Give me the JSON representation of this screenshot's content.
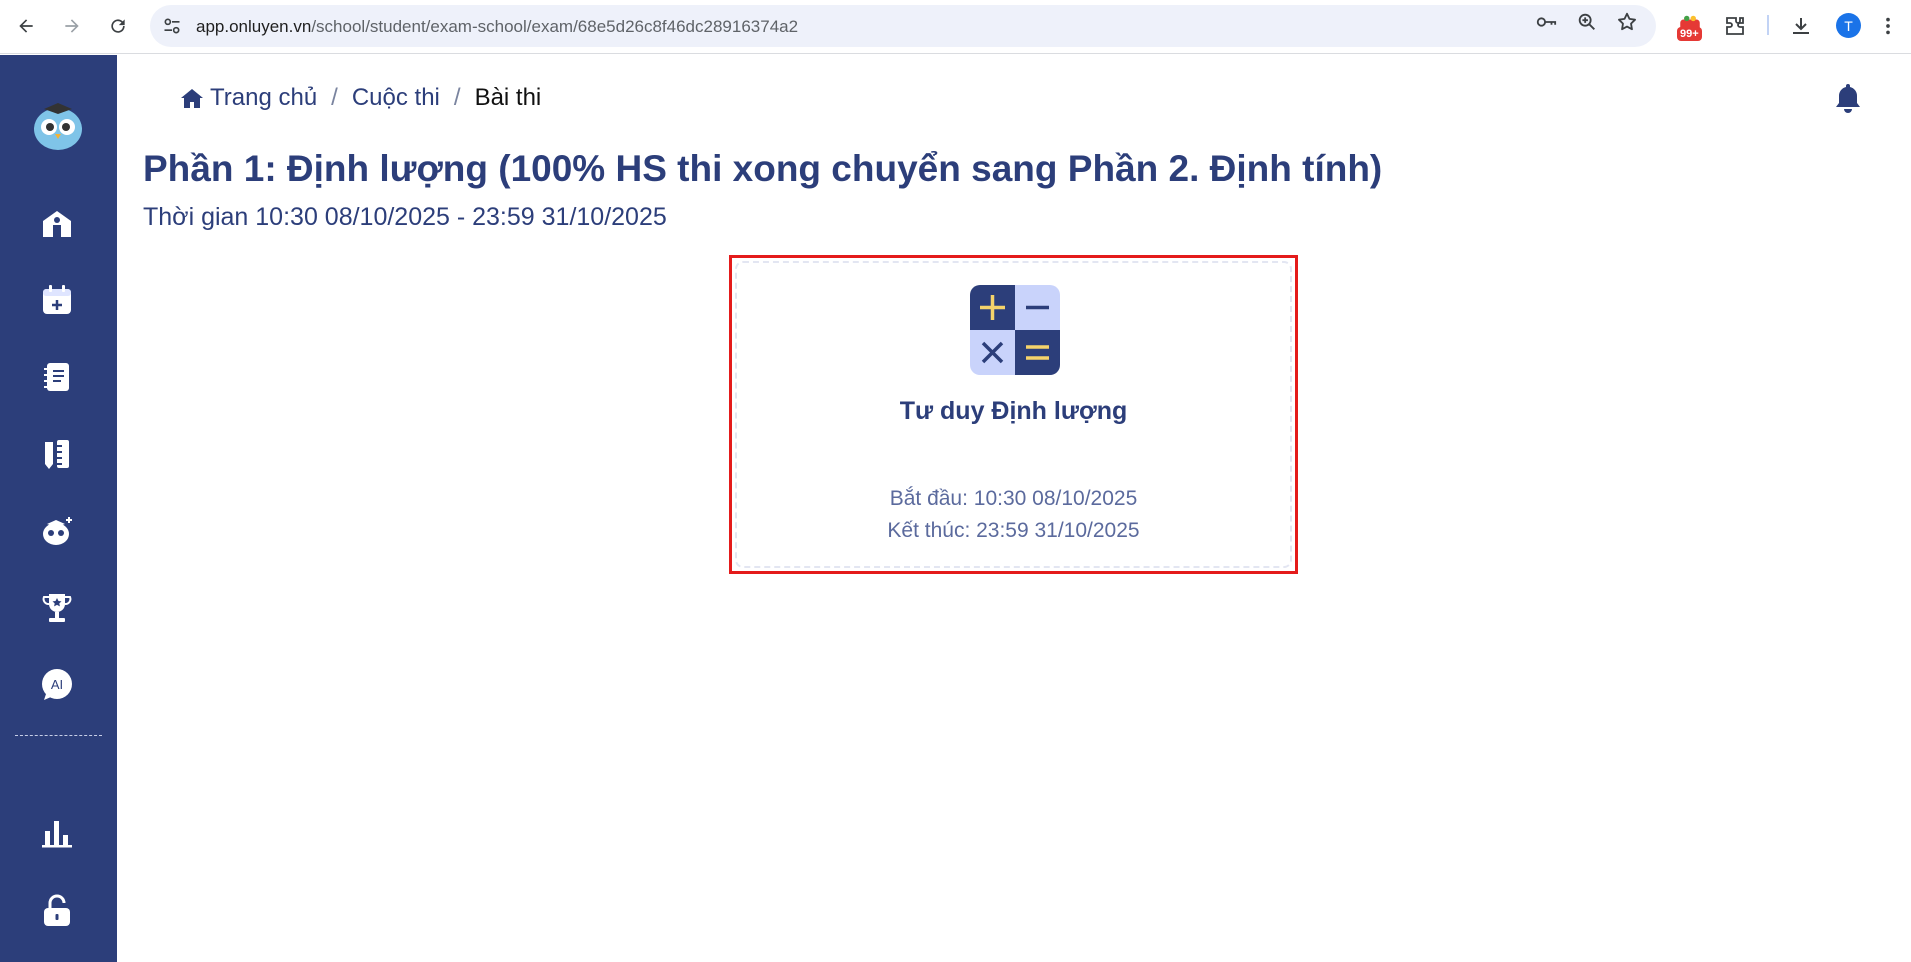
{
  "browser": {
    "url_host": "app.onluyen.vn",
    "url_path": "/school/student/exam-school/exam/68e5d26c8f46dc28916374a2",
    "extension_badge": "99+",
    "profile_initial": "T"
  },
  "breadcrumb": {
    "home": "Trang chủ",
    "contests": "Cuộc thi",
    "current": "Bài thi",
    "separator": "/"
  },
  "page": {
    "title": "Phần 1: Định lượng (100% HS thi xong chuyển sang Phần 2. Định tính)",
    "time_range": "Thời gian 10:30 08/10/2025 - 23:59 31/10/2025"
  },
  "exam_card": {
    "title": "Tư duy Định lượng",
    "start": "Bắt đầu: 10:30 08/10/2025",
    "end": "Kết thúc: 23:59 31/10/2025"
  },
  "sidebar": {
    "ai_label": "AI",
    "items": [
      "owl-logo",
      "school-icon",
      "calendar-add-icon",
      "notebook-icon",
      "pencil-ruler-icon",
      "owl-sparkle-icon",
      "trophy-icon",
      "ai-chat-icon",
      "bar-chart-icon",
      "unlock-icon"
    ]
  },
  "colors": {
    "sidebar": "#2c3e7a",
    "primary_text": "#2c3e7a",
    "highlight_border": "#e41b1b",
    "calc_dark": "#2c3e7a",
    "calc_light": "#c9d3fb",
    "calc_accent": "#f5d36b"
  }
}
